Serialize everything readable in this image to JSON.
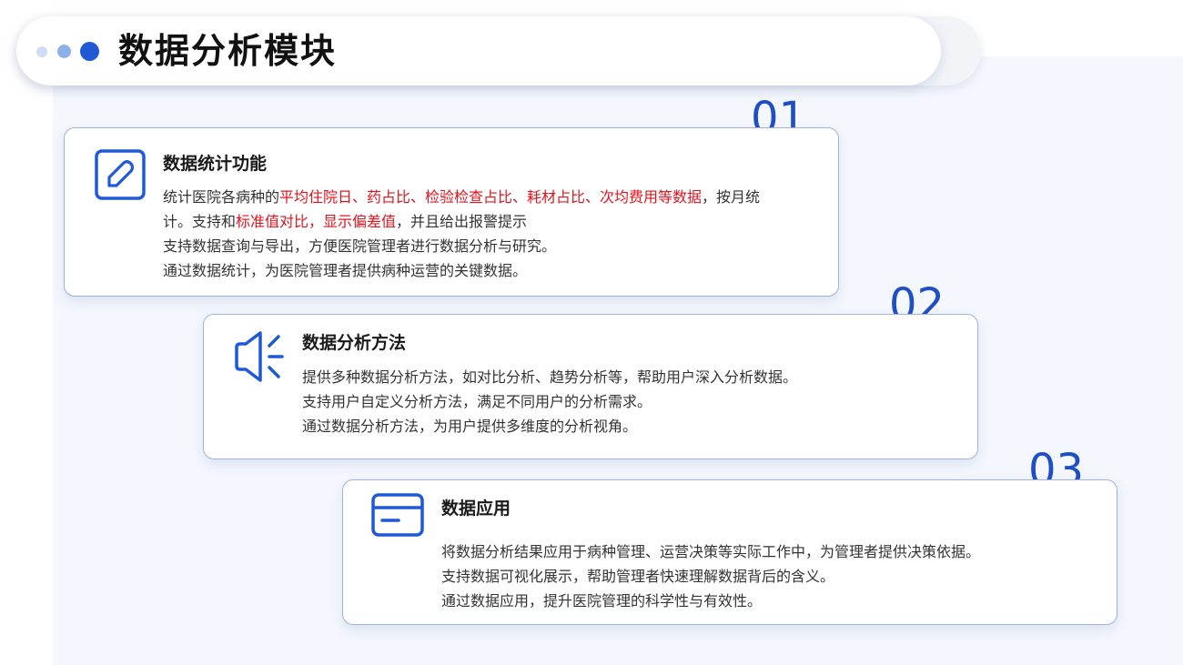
{
  "page": {
    "title": "数据分析模块"
  },
  "colors": {
    "accent": "#1f59d6",
    "highlight": "#e0141e",
    "border": "#9db3de"
  },
  "cards": [
    {
      "number": "01",
      "icon": "edit-pencil-icon",
      "title": "数据统计功能",
      "line1_pre": "统计医院各病种的",
      "line1_highlight": "平均住院日、药占比、检验检查占比、耗材占比、次均费用等数据",
      "line1_post": "，按月统",
      "line2_pre": "计。支持和",
      "line2_highlight": "标准值对比，显示偏差值",
      "line2_post": "，并且给出报警提示",
      "line3": "支持数据查询与导出，方便医院管理者进行数据分析与研究。",
      "line4": "通过数据统计，为医院管理者提供病种运营的关键数据。"
    },
    {
      "number": "02",
      "icon": "speaker-icon",
      "title": "数据分析方法",
      "line1": "提供多种数据分析方法，如对比分析、趋势分析等，帮助用户深入分析数据。",
      "line2": "支持用户自定义分析方法，满足不同用户的分析需求。",
      "line3": "通过数据分析方法，为用户提供多维度的分析视角。"
    },
    {
      "number": "03",
      "icon": "card-icon",
      "title": "数据应用",
      "line1": "将数据分析结果应用于病种管理、运营决策等实际工作中，为管理者提供决策依据。",
      "line2": "支持数据可视化展示，帮助管理者快速理解数据背后的含义。",
      "line3": "通过数据应用，提升医院管理的科学性与有效性。"
    }
  ]
}
